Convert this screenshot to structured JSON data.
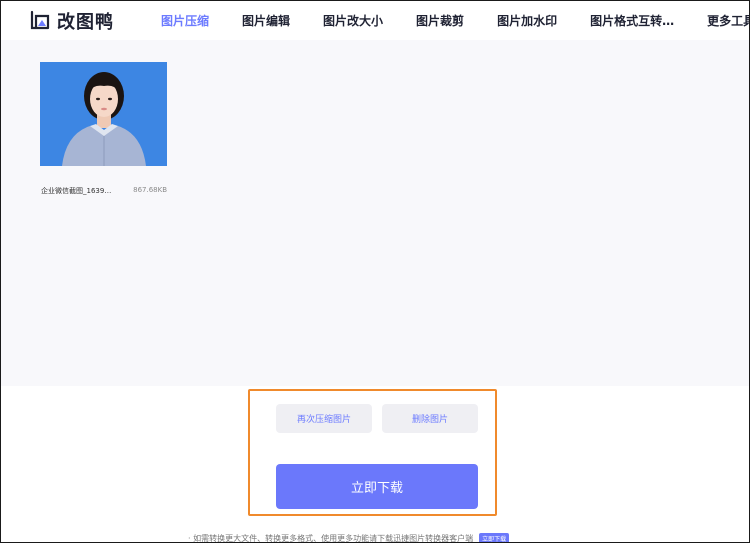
{
  "header": {
    "logo_text": "改图鸭",
    "nav": [
      {
        "label": "图片压缩",
        "active": true
      },
      {
        "label": "图片编辑",
        "active": false
      },
      {
        "label": "图片改大小",
        "active": false
      },
      {
        "label": "图片裁剪",
        "active": false
      },
      {
        "label": "图片加水印",
        "active": false
      },
      {
        "label": "图片格式互转…",
        "active": false
      },
      {
        "label": "更多工具…",
        "active": false
      }
    ]
  },
  "files": [
    {
      "name": "企业微信截图_1639…",
      "size": "867.68KB"
    }
  ],
  "actions": {
    "recompress_label": "再次压缩图片",
    "delete_label": "删除图片",
    "download_label": "立即下载"
  },
  "footer": {
    "note": "· 如需转换更大文件、转换更多格式、使用更多功能请下载迅捷图片转换器客户端",
    "button_label": "立即下载"
  },
  "colors": {
    "accent": "#6b78fb",
    "highlight_border": "#f08a2c",
    "thumb_background": "#3d86e3"
  }
}
